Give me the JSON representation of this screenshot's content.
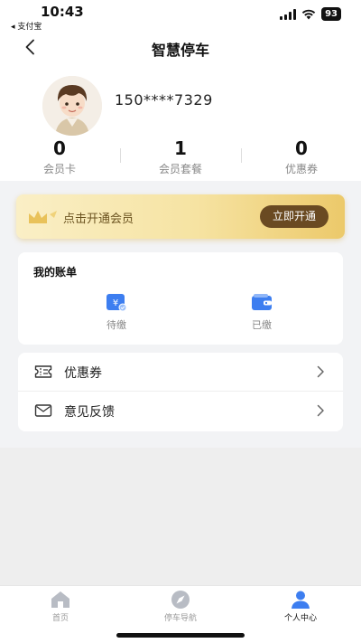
{
  "status_bar": {
    "time": "10:43",
    "back_app": "◂ 支付宝",
    "battery": "93"
  },
  "nav": {
    "title": "智慧停车"
  },
  "profile": {
    "phone": "150****7329"
  },
  "stats": [
    {
      "value": "0",
      "label": "会员卡"
    },
    {
      "value": "1",
      "label": "会员套餐"
    },
    {
      "value": "0",
      "label": "优惠券"
    }
  ],
  "member_banner": {
    "text": "点击开通会员",
    "button_label": "立即开通"
  },
  "bill": {
    "title": "我的账单",
    "items": [
      {
        "label": "待缴",
        "icon": "pending-payment-icon"
      },
      {
        "label": "已缴",
        "icon": "paid-wallet-icon"
      }
    ]
  },
  "menu": [
    {
      "label": "优惠券",
      "icon": "coupon-icon"
    },
    {
      "label": "意见反馈",
      "icon": "feedback-icon"
    }
  ],
  "tabs": [
    {
      "label": "首页",
      "icon": "home-icon"
    },
    {
      "label": "停车导航",
      "icon": "compass-icon"
    },
    {
      "label": "个人中心",
      "icon": "user-icon"
    }
  ],
  "colors": {
    "accent_blue": "#3d7ef0",
    "banner_gold": "#f3dc94",
    "button_brown": "#6a4a22"
  }
}
